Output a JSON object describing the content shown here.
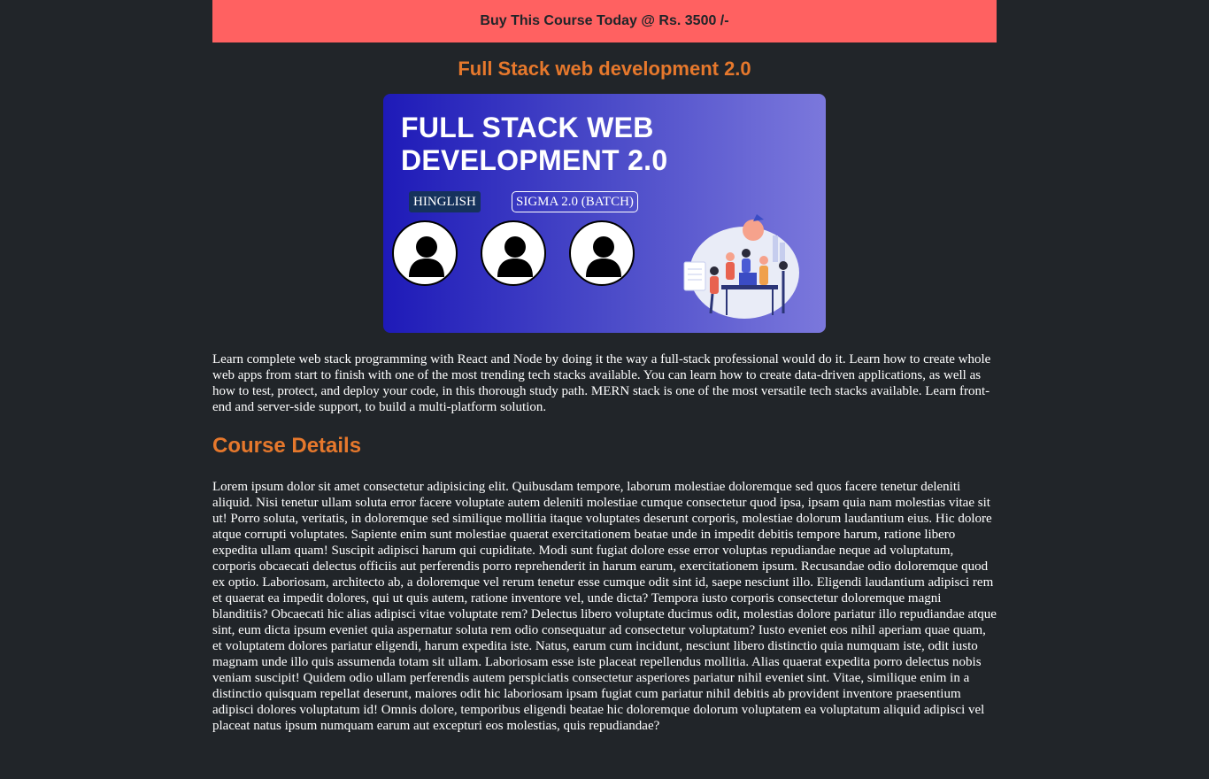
{
  "banner": {
    "buy_label": "Buy This Course Today @ Rs. 3500 /-"
  },
  "course": {
    "title": "Full Stack web development 2.0",
    "banner_heading_line1": "FULL STACK WEB",
    "banner_heading_line2": "DEVELOPMENT 2.0",
    "tag_language": "HINGLISH",
    "tag_batch": "SIGMA 2.0 (BATCH)",
    "avatar_icon": "user-silhouette-icon",
    "illustration_icon": "team-working-illustration",
    "intro": "Learn complete web stack programming with React and Node by doing it the way a full-stack professional would do it. Learn how to create whole web apps from start to finish with one of the most trending tech stacks available. You can learn how to create data-driven applications, as well as how to test, protect, and deploy your code, in this thorough study path. MERN stack is one of the most versatile tech stacks available. Learn front-end and server-side support, to build a multi-platform solution."
  },
  "details": {
    "heading": "Course Details",
    "body": "Lorem ipsum dolor sit amet consectetur adipisicing elit. Quibusdam tempore, laborum molestiae doloremque sed quos facere tenetur deleniti aliquid. Nisi tenetur ullam soluta error facere voluptate autem deleniti molestiae cumque consectetur quod ipsa, ipsam quia nam molestias vitae sit ut! Porro soluta, veritatis, in doloremque sed similique mollitia itaque voluptates deserunt corporis, molestiae dolorum laudantium eius. Hic dolore atque corrupti voluptates. Sapiente enim sunt molestiae quaerat exercitationem beatae unde in impedit debitis tempore harum, ratione libero expedita ullam quam! Suscipit adipisci harum qui cupiditate. Modi sunt fugiat dolore esse error voluptas repudiandae neque ad voluptatum, corporis obcaecati delectus officiis aut perferendis porro reprehenderit in harum earum, exercitationem ipsum. Recusandae odio doloremque quod ex optio. Laboriosam, architecto ab, a doloremque vel rerum tenetur esse cumque odit sint id, saepe nesciunt illo. Eligendi laudantium adipisci rem et quaerat ea impedit dolores, qui ut quis autem, ratione inventore vel, unde dicta? Tempora iusto corporis consectetur doloremque magni blanditiis? Obcaecati hic alias adipisci vitae voluptate rem? Delectus libero voluptate ducimus odit, molestias dolore pariatur illo repudiandae atque sint, eum dicta ipsum eveniet quia aspernatur soluta rem odio consequatur ad consectetur voluptatum? Iusto eveniet eos nihil aperiam quae quam, et voluptatem dolores pariatur eligendi, harum expedita iste. Natus, earum cum incidunt, nesciunt libero distinctio quia numquam iste, odit iusto magnam unde illo quis assumenda totam sit ullam. Laboriosam esse iste placeat repellendus mollitia. Alias quaerat expedita porro delectus nobis veniam suscipit! Quidem odio ullam perferendis autem perspiciatis consectetur asperiores pariatur nihil eveniet sint. Vitae, similique enim in a distinctio quisquam repellat deserunt, maiores odit hic laboriosam ipsam fugiat cum pariatur nihil debitis ab provident inventore praesentium adipisci dolores voluptatum id! Omnis dolore, temporibus eligendi beatae hic doloremque dolorum voluptatem ea voluptatum aliquid adipisci vel placeat natus ipsum numquam earum aut excepturi eos molestias, quis repudiandae?"
  },
  "colors": {
    "page_background": "#212529",
    "banner_background": "#ff6161",
    "accent": "#e6782c",
    "text": "#ffffff"
  }
}
